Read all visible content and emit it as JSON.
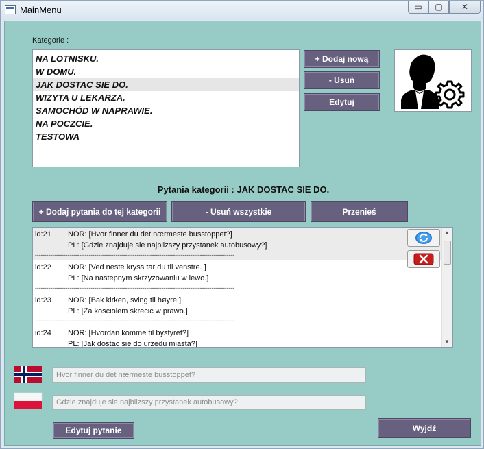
{
  "window": {
    "title": "MainMenu",
    "controls": {
      "minimize": "▭",
      "maximize": "▢",
      "close": "✕"
    }
  },
  "categories": {
    "label": "Kategorie :",
    "items": [
      {
        "label": "NA LOTNISKU."
      },
      {
        "label": "W DOMU."
      },
      {
        "label": "JAK DOSTAC SIE DO.",
        "selected": true
      },
      {
        "label": "WIZYTA U LEKARZA."
      },
      {
        "label": "SAMOCHÓD W NAPRAWIE."
      },
      {
        "label": "NA POCZCIE."
      },
      {
        "label": "TESTOWA"
      }
    ],
    "add_label": "+ Dodaj nową",
    "delete_label": "-  Usuń",
    "edit_label": "Edytuj"
  },
  "avatar": {
    "icon": "user-settings-icon"
  },
  "questions": {
    "heading": "Pytania kategorii : JAK DOSTAC SIE DO.",
    "add_label": "+ Dodaj pytania do tej kategorii",
    "delete_all_label": "- Usuń wszystkie",
    "move_label": "Przenieś",
    "separator": "--------------------------------------------------------------------------------------------------------",
    "items": [
      {
        "id": "id:21",
        "nor": "NOR: [Hvor finner du det nærmeste busstoppet?]",
        "pl": "PL: [Gdzie znajduje sie najblizszy przystanek autobusowy?]"
      },
      {
        "id": "id:22",
        "nor": "NOR: [Ved neste kryss tar du til venstre. ]",
        "pl": "PL: [Na nastepnym skrzyzowaniu w lewo.]"
      },
      {
        "id": "id:23",
        "nor": "NOR: [Bak kirken, sving til høyre.]",
        "pl": "PL: [Za kosciolem skrecic w prawo.]"
      },
      {
        "id": "id:24",
        "nor": "NOR: [Hvordan komme til bystyret?]",
        "pl": "PL: [Jak dostac sie do urzedu miasta?]"
      }
    ],
    "refresh_icon": "refresh-icon",
    "remove_icon": "remove-x-icon"
  },
  "editor": {
    "nor_flag": "norway-flag-icon",
    "pl_flag": "poland-flag-icon",
    "nor_placeholder": "Hvor finner du det nærmeste busstoppet?",
    "pl_placeholder": "Gdzie znajduje sie najblizszy przystanek autobusowy?",
    "edit_label": "Edytuj pytanie"
  },
  "exit_label": "Wyjdź"
}
